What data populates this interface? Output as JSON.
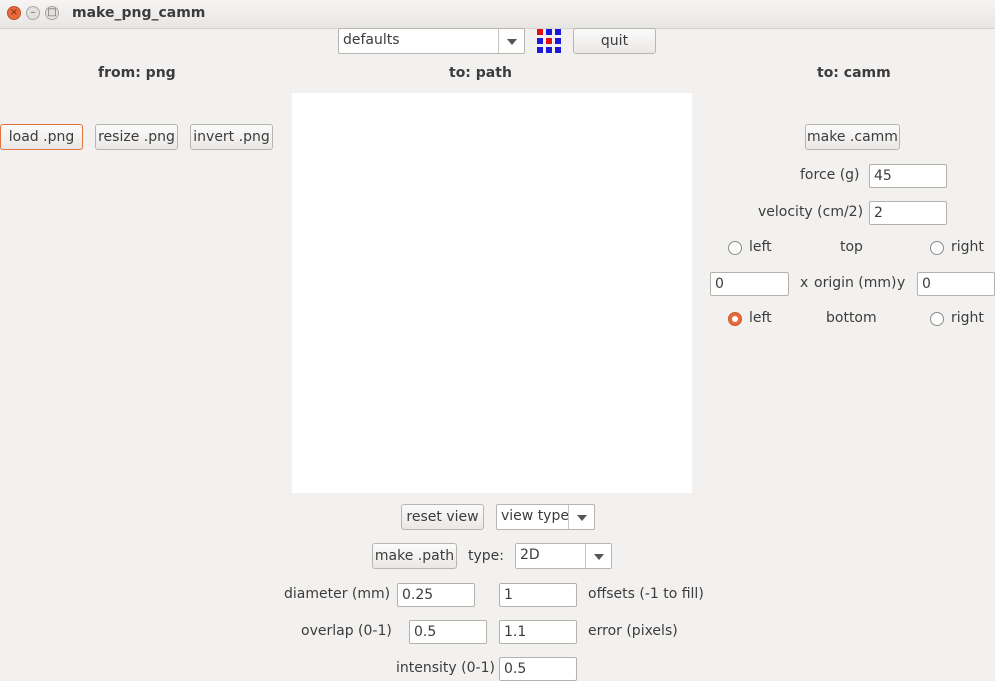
{
  "window": {
    "title": "make_png_camm"
  },
  "toolbar": {
    "defaults_value": "defaults",
    "quit_label": "quit",
    "logo_icon": "fab-grid-logo-icon"
  },
  "headers": {
    "from": "from: png",
    "path": "to: path",
    "camm": "to: camm"
  },
  "png_buttons": {
    "load": "load .png",
    "resize": "resize .png",
    "invert": "invert .png"
  },
  "camm": {
    "make_label": "make .camm",
    "force_label": "force (g)",
    "force_value": "45",
    "velocity_label": "velocity (cm/2)",
    "velocity_value": "2",
    "top_left": "left",
    "top_label": "top",
    "top_right": "right",
    "origin_x_value": "0",
    "x_label": "x",
    "origin_label": "origin (mm)",
    "y_label": "y",
    "origin_y_value": "0",
    "bottom_left": "left",
    "bottom_label": "bottom",
    "bottom_right": "right",
    "selected_origin": "bottom-left"
  },
  "path": {
    "reset_label": "reset view",
    "view_type_value": "view type",
    "make_label": "make .path",
    "type_label": "type:",
    "type_value": "2D",
    "diameter_label": "diameter (mm)",
    "diameter_value": "0.25",
    "offsets_value": "1",
    "offsets_label": "offsets (-1 to fill)",
    "overlap_label": "overlap (0-1)",
    "overlap_value": "0.5",
    "error_value": "1.1",
    "error_label": "error (pixels)",
    "intensity_label": "intensity (0-1)",
    "intensity_value": "0.5"
  },
  "colors": {
    "accent": "#e9683c",
    "logo_red": "#e01010",
    "logo_blue": "#1a1ad8"
  }
}
